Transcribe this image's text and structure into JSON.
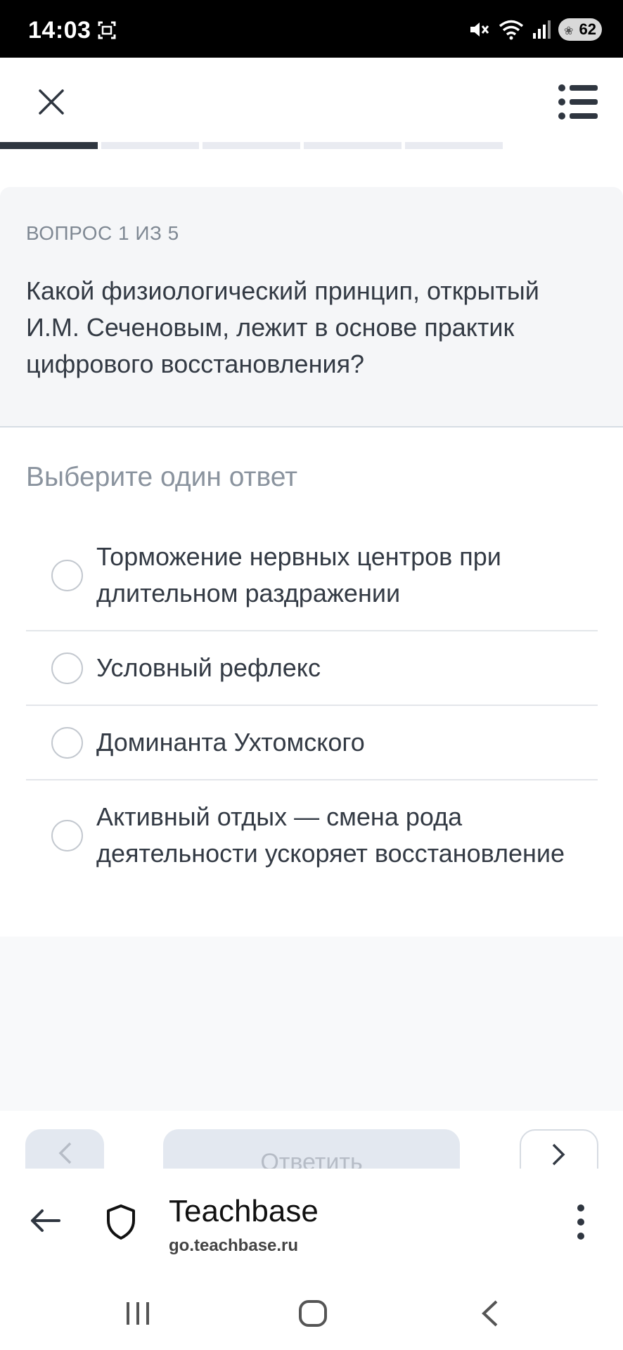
{
  "status_bar": {
    "time": "14:03",
    "battery": "62",
    "icons": [
      "screenshot-icon",
      "mute-icon",
      "wifi-icon",
      "signal-icon",
      "battery-icon"
    ]
  },
  "top_bar": {
    "icons": [
      "close-icon",
      "list-menu-icon"
    ]
  },
  "progress": {
    "current": 1,
    "total": 5
  },
  "question": {
    "counter": "ВОПРОС 1 ИЗ 5",
    "text": "Какой физиологический принцип, открытый И.М. Сеченовым, лежит в основе практик цифрового восстановления?"
  },
  "answers": {
    "heading": "Выберите один ответ",
    "options": [
      {
        "label": "Торможение нервных центров при длительном раздражении",
        "selected": false
      },
      {
        "label": "Условный рефлекс",
        "selected": false
      },
      {
        "label": "Доминанта Ухтомского",
        "selected": false
      },
      {
        "label": "Активный отдых — смена рода деятельности ускоряет восстановление",
        "selected": false
      }
    ]
  },
  "nav_buttons": {
    "prev_icon": "chevron-left-icon",
    "answer_label": "Ответить",
    "next_icon": "chevron-right-icon"
  },
  "browser": {
    "title": "Teachbase",
    "url": "go.teachbase.ru",
    "icons": [
      "back-arrow-icon",
      "shield-icon",
      "more-vertical-icon"
    ]
  },
  "system_nav": {
    "icons": [
      "recent-apps-icon",
      "home-icon",
      "back-icon"
    ]
  },
  "colors": {
    "accent": "#2f3640",
    "card_bg": "#f5f6f8",
    "muted": "#8a939e",
    "button_disabled": "#e3e8f0"
  }
}
